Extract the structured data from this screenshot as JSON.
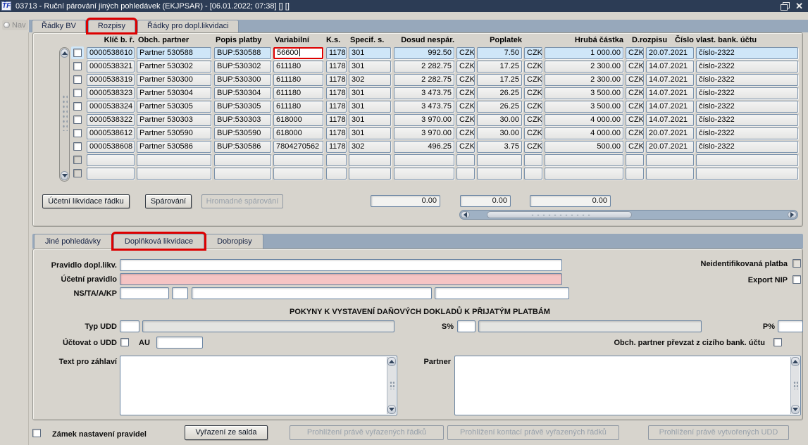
{
  "window": {
    "logo": "ŤF",
    "title": "03713 - Ruční párování jiných pohledávek (EKJPSAR) - [06.01.2022; 07:38] [] []",
    "nav_label": "Nav",
    "close_glyph": "✕"
  },
  "top_tabs": [
    {
      "label": "Řádky BV",
      "highlight": false
    },
    {
      "label": "Rozpisy",
      "highlight": true
    },
    {
      "label": "Řádky pro dopl.likvidaci",
      "highlight": false
    }
  ],
  "table": {
    "columns": [
      "Klíč b. ř.",
      "Obch. partner",
      "Popis platby",
      "Variabilní",
      "K.s.",
      "Specif. s.",
      "Dosud nespár.",
      "Poplatek",
      "Hrubá částka",
      "D.rozpisu",
      "Číslo vlast. bank. účtu"
    ],
    "selected_row": 0,
    "focused_cell": {
      "row": 0,
      "col": 3
    },
    "rows": [
      {
        "cells": [
          "0000538610",
          "Partner 530588",
          "BUP:530588",
          "56600",
          "1178",
          "301",
          "992.50",
          "CZK",
          "7.50",
          "CZK",
          "1 000.00",
          "CZK",
          "20.07.2021",
          "číslo-2322"
        ]
      },
      {
        "cells": [
          "0000538321",
          "Partner 530302",
          "BUP:530302",
          "611180",
          "1178",
          "301",
          "2 282.75",
          "CZK",
          "17.25",
          "CZK",
          "2 300.00",
          "CZK",
          "14.07.2021",
          "číslo-2322"
        ]
      },
      {
        "cells": [
          "0000538319",
          "Partner 530300",
          "BUP:530300",
          "611180",
          "1178",
          "302",
          "2 282.75",
          "CZK",
          "17.25",
          "CZK",
          "2 300.00",
          "CZK",
          "14.07.2021",
          "číslo-2322"
        ]
      },
      {
        "cells": [
          "0000538323",
          "Partner 530304",
          "BUP:530304",
          "611180",
          "1178",
          "301",
          "3 473.75",
          "CZK",
          "26.25",
          "CZK",
          "3 500.00",
          "CZK",
          "14.07.2021",
          "číslo-2322"
        ]
      },
      {
        "cells": [
          "0000538324",
          "Partner 530305",
          "BUP:530305",
          "611180",
          "1178",
          "301",
          "3 473.75",
          "CZK",
          "26.25",
          "CZK",
          "3 500.00",
          "CZK",
          "14.07.2021",
          "číslo-2322"
        ]
      },
      {
        "cells": [
          "0000538322",
          "Partner 530303",
          "BUP:530303",
          "618000",
          "1178",
          "301",
          "3 970.00",
          "CZK",
          "30.00",
          "CZK",
          "4 000.00",
          "CZK",
          "14.07.2021",
          "číslo-2322"
        ]
      },
      {
        "cells": [
          "0000538612",
          "Partner 530590",
          "BUP:530590",
          "618000",
          "1178",
          "301",
          "3 970.00",
          "CZK",
          "30.00",
          "CZK",
          "4 000.00",
          "CZK",
          "20.07.2021",
          "číslo-2322"
        ]
      },
      {
        "cells": [
          "0000538608",
          "Partner 530586",
          "BUP:530586",
          "7804270562",
          "1178",
          "302",
          "496.25",
          "CZK",
          "3.75",
          "CZK",
          "500.00",
          "CZK",
          "20.07.2021",
          "číslo-2322"
        ]
      },
      {
        "cells": [
          "",
          "",
          "",
          "",
          "",
          "",
          "",
          "",
          "",
          "",
          "",
          "",
          "",
          ""
        ]
      },
      {
        "cells": [
          "",
          "",
          "",
          "",
          "",
          "",
          "",
          "",
          "",
          "",
          "",
          "",
          "",
          ""
        ]
      }
    ]
  },
  "toolbar": {
    "buttons": [
      {
        "label": "Účetní likvidace řádku",
        "enabled": true
      },
      {
        "label": "Spárování",
        "enabled": true
      },
      {
        "label": "Hromadné spárování",
        "enabled": false
      }
    ],
    "totals": [
      "0.00",
      "0.00",
      "0.00"
    ]
  },
  "lower_tabs": [
    {
      "label": "Jiné pohledávky",
      "highlight": false
    },
    {
      "label": "Doplňková likvidace",
      "highlight": true
    },
    {
      "label": "Dobropisy",
      "highlight": false
    }
  ],
  "form": {
    "pravidlo_label": "Pravidlo dopl.likv.",
    "pravidlo_value": "",
    "ucetni_label": "Účetní pravidlo",
    "ucetni_value": "",
    "ns_label": "NS/TA/A/KP",
    "neident_label": "Neidentifikovaná platba",
    "export_label": "Export NIP",
    "pokyny_header": "POKYNY K VYSTAVENÍ DAŇOVÝCH DOKLADŮ K PŘIJATÝM PLATBÁM",
    "typ_udd_label": "Typ UDD",
    "s_label": "S%",
    "p_label": "P%",
    "uctovat_label": "Účtovat o UDD",
    "au_label": "AU",
    "obch_label": "Obch. partner převzat z cizího bank. účtu",
    "text_zahlavi_label": "Text pro záhlaví",
    "partner_label": "Partner"
  },
  "bottom": {
    "zamek_label": "Zámek nastavení pravidel",
    "buttons": [
      {
        "label": "Vyřazení ze salda",
        "enabled": true
      },
      {
        "label": "Prohlížení právě vyřazených řádků",
        "enabled": false
      },
      {
        "label": "Prohlížení kontací právě vyřazených řádků",
        "enabled": false
      },
      {
        "label": "Prohlížení právě vytvořených UDD",
        "enabled": false
      }
    ]
  },
  "colors": {
    "highlight_red": "#dd0000",
    "selected_row": "#cfe6f8",
    "required_pink": "#f5c4c4",
    "titlebar": "#2c3c55"
  }
}
